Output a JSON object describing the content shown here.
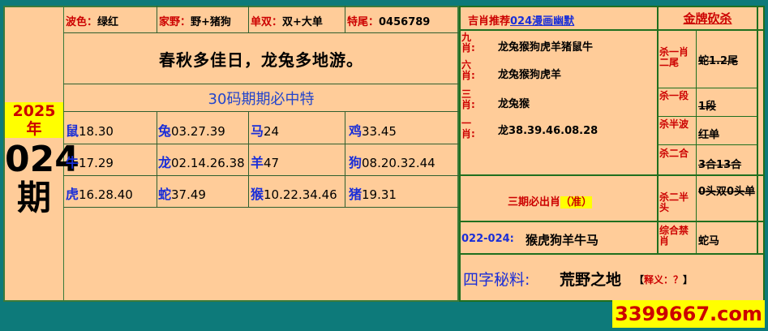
{
  "header": {
    "year": "2025年",
    "period_num": "024",
    "period_char": "期"
  },
  "info": {
    "wave_label": "波色：",
    "wave_value": "绿红",
    "home_label": "家野：",
    "home_value": "野+猪狗",
    "odd_label": "单双：",
    "odd_value": "双+大单",
    "tail_label": "特尾：",
    "tail_value": "0456789"
  },
  "slogan": "春秋多佳日，龙兔多地游。",
  "subtitle": "30码期期必中特",
  "zodiac_grid": [
    [
      {
        "z": "鼠",
        "n": "18.30"
      },
      {
        "z": "兔",
        "n": "03.27.39"
      },
      {
        "z": "马",
        "n": "24"
      },
      {
        "z": "鸡",
        "n": "33.45"
      }
    ],
    [
      {
        "z": "牛",
        "n": "17.29"
      },
      {
        "z": "龙",
        "n": "02.14.26.38"
      },
      {
        "z": "羊",
        "n": "47"
      },
      {
        "z": "狗",
        "n": "08.20.32.44"
      }
    ],
    [
      {
        "z": "虎",
        "n": "16.28.40"
      },
      {
        "z": "蛇",
        "n": "37.49"
      },
      {
        "z": "猴",
        "n": "10.22.34.46"
      },
      {
        "z": "猪",
        "n": "19.31"
      }
    ]
  ],
  "right": {
    "recommend_title": "吉肖推荐",
    "recommend_link": "024漫画幽默",
    "gold_title": "金牌砍杀",
    "picks": [
      {
        "label": "九肖:",
        "value": "龙兔猴狗虎羊猪鼠牛"
      },
      {
        "label": "六肖:",
        "value": "龙兔猴狗虎羊"
      },
      {
        "label": "三肖:",
        "value": "龙兔猴"
      },
      {
        "label": "一肖:",
        "value": "龙38.39.46.08.28"
      }
    ],
    "kills": [
      {
        "label": "杀一肖二尾",
        "value": "蛇1.2尾"
      },
      {
        "label": "杀一段",
        "value": "1段"
      },
      {
        "label": "杀半波",
        "value": "红单"
      },
      {
        "label": "杀二合",
        "value": "3合13合"
      },
      {
        "label": "杀二半头",
        "value": "0头双0头单"
      },
      {
        "label": "综合禁肖",
        "value": "蛇马"
      }
    ],
    "three_period_label": "三期必出肖",
    "three_period_tag": "（准）",
    "range_label": "022-024:",
    "range_value": "猴虎狗羊牛马",
    "secret_label": "四字秘料:",
    "secret_value": "荒野之地",
    "secret_note_open": "【",
    "secret_note": "释义：？",
    "secret_note_close": "】"
  },
  "site": "3399667.com"
}
